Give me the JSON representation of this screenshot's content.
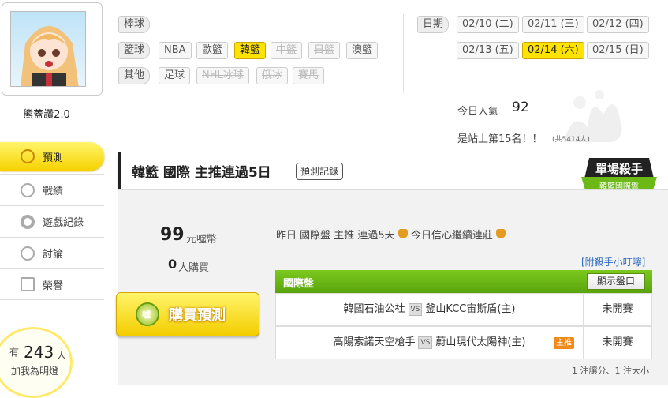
{
  "user": {
    "name": "熊蓋讚2.0"
  },
  "sidebar": {
    "items": [
      {
        "label": "預測",
        "icon": "target-icon"
      },
      {
        "label": "戰績",
        "icon": "medal-icon"
      },
      {
        "label": "遊戲紀錄",
        "icon": "circle-icon"
      },
      {
        "label": "討論",
        "icon": "chat-icon"
      },
      {
        "label": "榮譽",
        "icon": "award-icon"
      }
    ]
  },
  "lamp": {
    "prefix": "有",
    "count": "243",
    "unit": "人",
    "text": "加我為明燈"
  },
  "filters": {
    "baseball": {
      "label": "棒球"
    },
    "basketball": {
      "label": "籃球",
      "tags": [
        "NBA",
        "歐籃",
        "韓籃",
        "中籃",
        "日籃",
        "澳籃"
      ]
    },
    "other": {
      "label": "其他",
      "tags": [
        "足球",
        "NHL冰球",
        "俄冰",
        "賽馬"
      ]
    }
  },
  "dates": {
    "label": "日期",
    "items": [
      "02/10 (二)",
      "02/11 (三)",
      "02/12 (四)",
      "02/13 (五)",
      "02/14 (六)",
      "02/15 (日)"
    ]
  },
  "popularity": {
    "label": "今日人氣",
    "value": "92",
    "rank_text": "是站上第15名！！",
    "rank_sub": "(共5414人)"
  },
  "header": {
    "title": "韓籃 國際 主推連過5日",
    "record_button": "預測記錄"
  },
  "badge": {
    "line1": "單場殺手",
    "line2": "韓籃國際盤"
  },
  "purchase": {
    "price": "99",
    "price_unit": "元噓幣",
    "buyers": "0",
    "buyers_unit": "人購買",
    "button": "購買預測",
    "coin": "噓"
  },
  "headline": {
    "part1": "昨日 國際盤 主推 連過5天",
    "part2": " 今日信心繼續連莊"
  },
  "tip_link": "[附殺手小叮嚀]",
  "market": {
    "title": "國際盤",
    "show_button": "顯示盤口",
    "vs": "VS",
    "main_tag": "主推",
    "rows": [
      {
        "home": "韓國石油公社",
        "away": "釜山KCC宙斯盾(主)",
        "status": "未開賽"
      },
      {
        "home": "高陽索諾天空槍手",
        "away": "蔚山現代太陽神(主)",
        "status": "未開賽"
      }
    ]
  },
  "footer_note": "1 注讓分、1 注大小",
  "colors": {
    "accent": "#ffe300",
    "market_green": "#6cb817",
    "tag_orange": "#f08a1c",
    "link": "#2a6ac0"
  }
}
